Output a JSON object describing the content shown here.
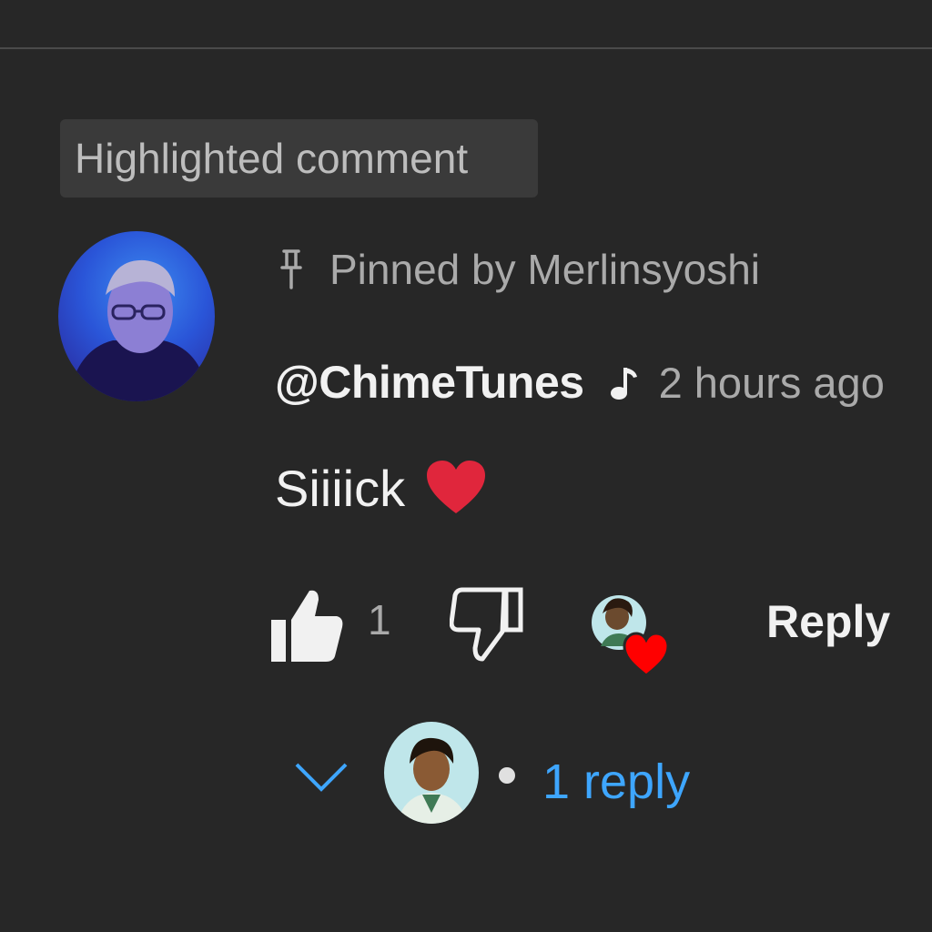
{
  "badge": {
    "label": "Highlighted comment"
  },
  "comment": {
    "pinned_text": "Pinned by Merlinsyoshi",
    "author": "@ChimeTunes",
    "timestamp": "2 hours ago",
    "text": "Siiiick",
    "like_count": "1",
    "reply_label": "Reply",
    "replies_label": "1 reply"
  },
  "icons": {
    "pin": "pin-icon",
    "music_note": "music-note-icon",
    "heart_emoji": "heart-emoji-icon",
    "like": "thumbs-up-icon",
    "dislike": "thumbs-down-icon",
    "creator_heart": "creator-heart-icon",
    "expand": "chevron-down-icon"
  },
  "colors": {
    "background": "#272727",
    "link": "#3ea6ff",
    "heart": "#ff0000",
    "muted_text": "#aaaaaa"
  }
}
